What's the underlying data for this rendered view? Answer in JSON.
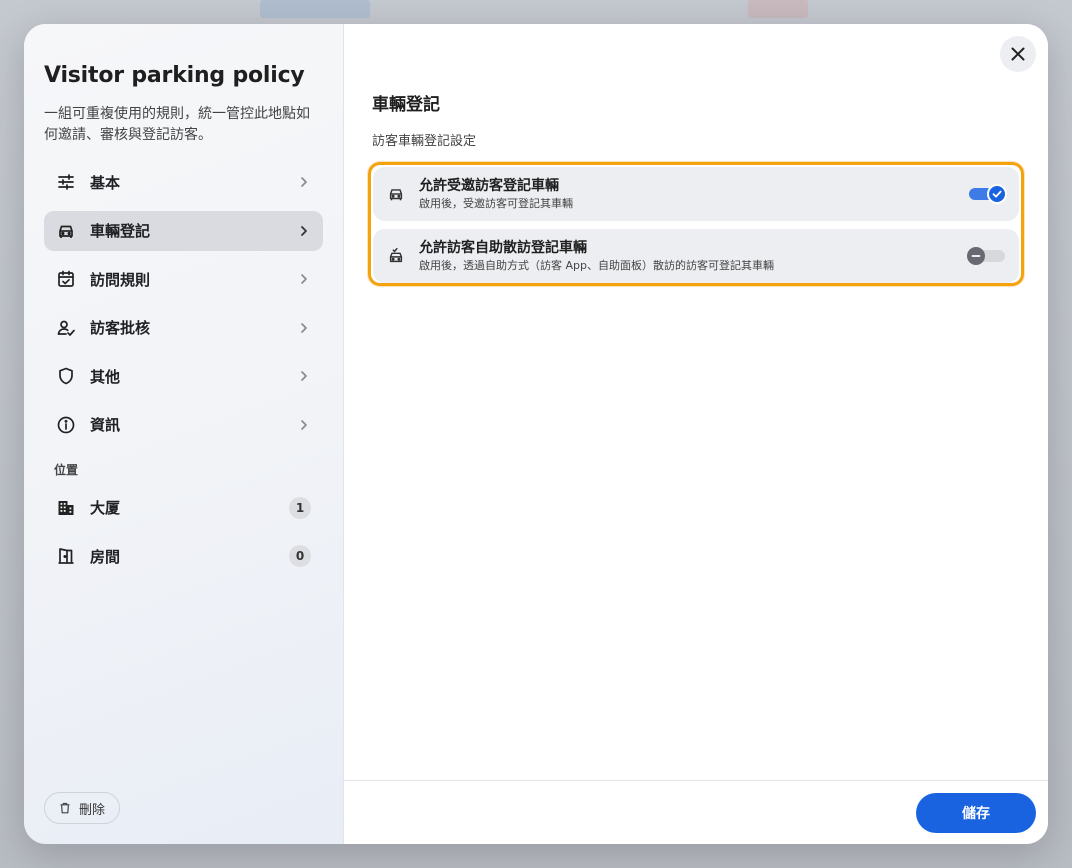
{
  "sidebar": {
    "title": "Visitor parking policy",
    "description": "一組可重複使用的規則，統一管控此地點如何邀請、審核與登記訪客。",
    "nav": [
      {
        "label": "基本",
        "icon": "sliders-icon"
      },
      {
        "label": "車輛登記",
        "icon": "car-icon",
        "active": true
      },
      {
        "label": "訪問規則",
        "icon": "calendar-check-icon"
      },
      {
        "label": "訪客批核",
        "icon": "person-check-icon"
      },
      {
        "label": "其他",
        "icon": "shield-icon"
      },
      {
        "label": "資訊",
        "icon": "info-icon"
      }
    ],
    "location_section_label": "位置",
    "locations": [
      {
        "label": "大厦",
        "count": "1",
        "icon": "building-icon"
      },
      {
        "label": "房間",
        "count": "0",
        "icon": "door-icon"
      }
    ],
    "delete_label": "刪除"
  },
  "content": {
    "title": "車輛登記",
    "subtitle": "訪客車輛登記設定",
    "options": [
      {
        "title": "允許受邀訪客登記車輛",
        "description": "啟用後，受邀訪客可登記其車輛",
        "enabled": true
      },
      {
        "title": "允許訪客自助散訪登記車輛",
        "description": "啟用後，透過自助方式（訪客 App、自助面板）散訪的訪客可登記其車輛",
        "enabled": false
      }
    ],
    "save_label": "儲存"
  },
  "colors": {
    "primary": "#1a63e0",
    "highlight_border": "#f4a20e"
  }
}
